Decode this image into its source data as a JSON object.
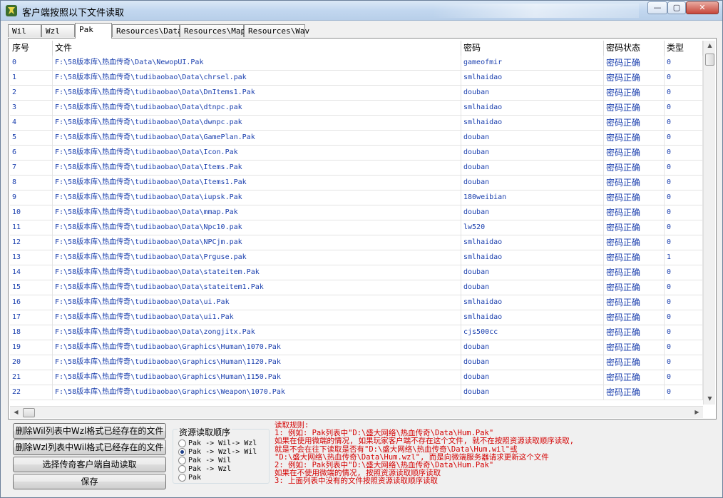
{
  "window": {
    "title": "客户端按照以下文件读取",
    "min_glyph": "—",
    "max_glyph": "▢",
    "close_glyph": "✕"
  },
  "tabs": [
    "Wil",
    "Wzl",
    "Pak",
    "Resources\\Data",
    "Resources\\Map",
    "Resources\\Wav"
  ],
  "active_tab": "Pak",
  "table": {
    "columns": [
      "序号",
      "文件",
      "密码",
      "密码状态",
      "类型"
    ],
    "rows": [
      [
        "0",
        "F:\\58版本库\\热血传奇\\Data\\NewopUI.Pak",
        "gameofmir",
        "密码正确",
        "0"
      ],
      [
        "1",
        "F:\\58版本库\\热血传奇\\tudibaobao\\Data\\chrsel.pak",
        "smlhaidao",
        "密码正确",
        "0"
      ],
      [
        "2",
        "F:\\58版本库\\热血传奇\\tudibaobao\\Data\\DnItems1.Pak",
        "douban",
        "密码正确",
        "0"
      ],
      [
        "3",
        "F:\\58版本库\\热血传奇\\tudibaobao\\Data\\dtnpc.pak",
        "smlhaidao",
        "密码正确",
        "0"
      ],
      [
        "4",
        "F:\\58版本库\\热血传奇\\tudibaobao\\Data\\dwnpc.pak",
        "smlhaidao",
        "密码正确",
        "0"
      ],
      [
        "5",
        "F:\\58版本库\\热血传奇\\tudibaobao\\Data\\GamePlan.Pak",
        "douban",
        "密码正确",
        "0"
      ],
      [
        "6",
        "F:\\58版本库\\热血传奇\\tudibaobao\\Data\\Icon.Pak",
        "douban",
        "密码正确",
        "0"
      ],
      [
        "7",
        "F:\\58版本库\\热血传奇\\tudibaobao\\Data\\Items.Pak",
        "douban",
        "密码正确",
        "0"
      ],
      [
        "8",
        "F:\\58版本库\\热血传奇\\tudibaobao\\Data\\Items1.Pak",
        "douban",
        "密码正确",
        "0"
      ],
      [
        "9",
        "F:\\58版本库\\热血传奇\\tudibaobao\\Data\\iupsk.Pak",
        "180weibian",
        "密码正确",
        "0"
      ],
      [
        "10",
        "F:\\58版本库\\热血传奇\\tudibaobao\\Data\\mmap.Pak",
        "douban",
        "密码正确",
        "0"
      ],
      [
        "11",
        "F:\\58版本库\\热血传奇\\tudibaobao\\Data\\Npc10.pak",
        "lw520",
        "密码正确",
        "0"
      ],
      [
        "12",
        "F:\\58版本库\\热血传奇\\tudibaobao\\Data\\NPCjm.pak",
        "smlhaidao",
        "密码正确",
        "0"
      ],
      [
        "13",
        "F:\\58版本库\\热血传奇\\tudibaobao\\Data\\Prguse.pak",
        "smlhaidao",
        "密码正确",
        "1"
      ],
      [
        "14",
        "F:\\58版本库\\热血传奇\\tudibaobao\\Data\\stateitem.Pak",
        "douban",
        "密码正确",
        "0"
      ],
      [
        "15",
        "F:\\58版本库\\热血传奇\\tudibaobao\\Data\\stateitem1.Pak",
        "douban",
        "密码正确",
        "0"
      ],
      [
        "16",
        "F:\\58版本库\\热血传奇\\tudibaobao\\Data\\ui.Pak",
        "smlhaidao",
        "密码正确",
        "0"
      ],
      [
        "17",
        "F:\\58版本库\\热血传奇\\tudibaobao\\Data\\ui1.Pak",
        "smlhaidao",
        "密码正确",
        "0"
      ],
      [
        "18",
        "F:\\58版本库\\热血传奇\\tudibaobao\\Data\\zongjitx.Pak",
        "cjs500cc",
        "密码正确",
        "0"
      ],
      [
        "19",
        "F:\\58版本库\\热血传奇\\tudibaobao\\Graphics\\Human\\1070.Pak",
        "douban",
        "密码正确",
        "0"
      ],
      [
        "20",
        "F:\\58版本库\\热血传奇\\tudibaobao\\Graphics\\Human\\1120.Pak",
        "douban",
        "密码正确",
        "0"
      ],
      [
        "21",
        "F:\\58版本库\\热血传奇\\tudibaobao\\Graphics\\Human\\1150.Pak",
        "douban",
        "密码正确",
        "0"
      ],
      [
        "22",
        "F:\\58版本库\\热血传奇\\tudibaobao\\Graphics\\Weapon\\1070.Pak",
        "douban",
        "密码正确",
        "0"
      ]
    ]
  },
  "buttons": {
    "delete_wil": "删除Wil列表中Wzl格式已经存在的文件",
    "delete_wzl": "删除Wzl列表中Wil格式已经存在的文件",
    "select_client": "选择传奇客户端自动读取",
    "save": "保存"
  },
  "resource_order": {
    "title": "资源读取顺序",
    "options": [
      "Pak -> Wil-> Wzl",
      "Pak -> Wzl-> Wil",
      "Pak -> Wil",
      "Pak -> Wzl",
      "Pak"
    ],
    "selected_index": 1
  },
  "rules": [
    "读取规则:",
    "1: 例如: Pak列表中\"D:\\盛大网络\\热血传奇\\Data\\Hum.Pak\"",
    "    如果在使用微端的情况, 如果玩家客户端不存在这个文件, 就不在按照资源读取顺序读取,",
    "    就是不会在往下读取是否有\"D:\\盛大网络\\热血传奇\\Data\\Hum.wil\"或",
    "  \"D:\\盛大网络\\热血传奇\\Data\\Hum.wzl\", 而是向微端服务器请求更新这个文件",
    "2: 例如: Pak列表中\"D:\\盛大网络\\热血传奇\\Data\\Hum.Pak\"",
    "    如果在不使用微端的情况, 按照资源读取顺序读取",
    "3: 上面列表中没有的文件按照资源读取顺序读取"
  ],
  "colors": {
    "cell_text": "#1a3fae",
    "rules_text": "#d40000",
    "titlebar": "#c2d7ef"
  }
}
